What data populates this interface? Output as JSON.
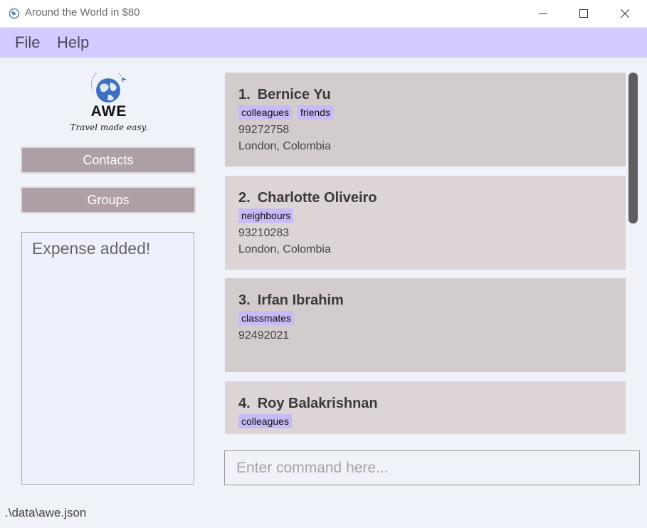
{
  "window": {
    "title": "Around the World in $80",
    "controls": [
      "minimize-icon",
      "maximize-icon",
      "close-icon"
    ]
  },
  "menu": {
    "file": "File",
    "help": "Help"
  },
  "logo": {
    "word": "AWE",
    "tagline": "Travel made easy."
  },
  "nav": {
    "contacts": "Contacts",
    "groups": "Groups"
  },
  "result": {
    "message": "Expense added!"
  },
  "contacts": [
    {
      "index": "1.",
      "name": "Bernice Yu",
      "tags": [
        "colleagues",
        "friends"
      ],
      "phone": "99272758",
      "address": "London, Colombia"
    },
    {
      "index": "2.",
      "name": "Charlotte Oliveiro",
      "tags": [
        "neighbours"
      ],
      "phone": "93210283",
      "address": "London, Colombia"
    },
    {
      "index": "3.",
      "name": "Irfan Ibrahim",
      "tags": [
        "classmates"
      ],
      "phone": "92492021",
      "address": ""
    },
    {
      "index": "4.",
      "name": "Roy Balakrishnan",
      "tags": [
        "colleagues"
      ],
      "phone": "",
      "address": ""
    }
  ],
  "command": {
    "placeholder": "Enter command here..."
  },
  "status": {
    "path": ".\\data\\awe.json"
  },
  "colors": {
    "menubar": "#d3caff",
    "tag": "#c6baf7",
    "nav_button": "#ada0a6",
    "card_odd": "#d2cccc",
    "card_even": "#ddd4d5",
    "scroll_thumb": "#5e5e5e"
  }
}
